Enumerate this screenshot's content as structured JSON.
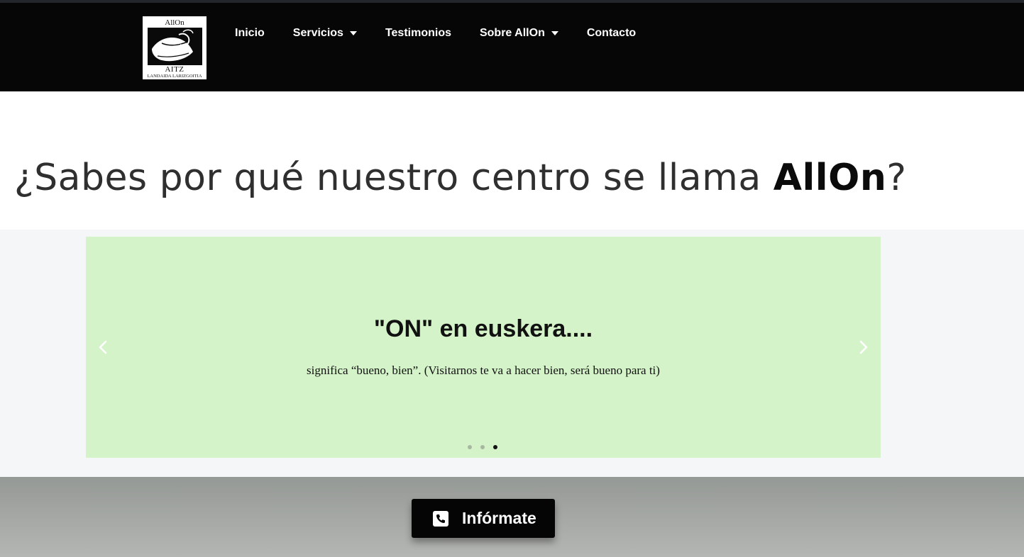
{
  "logo": {
    "top_text": "AllOn",
    "mark": "AITZ",
    "subtext": "LANDAIDA LARIZGOITIA"
  },
  "nav": {
    "items": [
      {
        "label": "Inicio"
      },
      {
        "label": "Servicios"
      },
      {
        "label": "Testimonios"
      },
      {
        "label": "Sobre AllOn"
      },
      {
        "label": "Contacto"
      }
    ]
  },
  "headline": {
    "prefix": "¿Sabes por qué nuestro centro se llama ",
    "emphasis": "AllOn",
    "suffix": "?"
  },
  "slider": {
    "title": "\"ON\" en euskera....",
    "text": "significa “bueno, bien”. (Visitarnos te va a hacer bien, será bueno para ti)",
    "active_dot": 3,
    "total_dots": 3
  },
  "cta": {
    "label": "Infórmate",
    "icon": "phone-icon"
  },
  "colors": {
    "header_bg": "#060606",
    "slide_bg": "#d5f3c9",
    "band_bg": "#f5f6f7",
    "cta_bg": "#050505"
  }
}
